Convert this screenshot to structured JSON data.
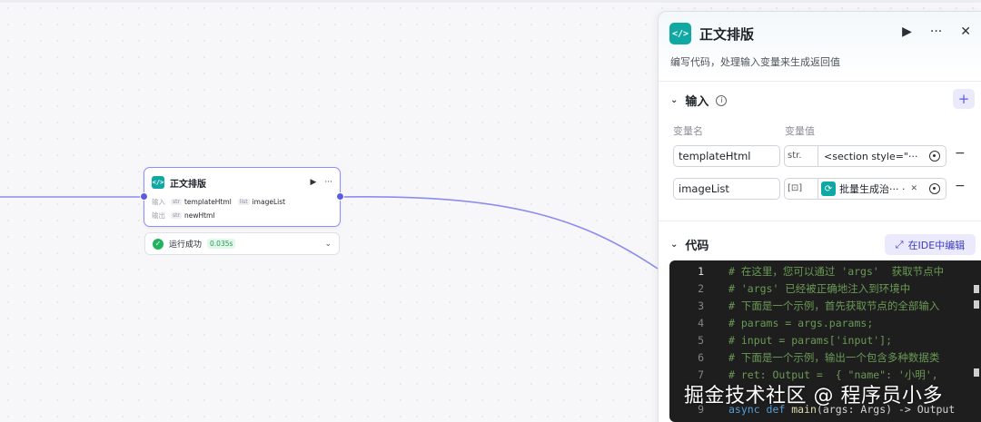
{
  "canvas": {
    "node": {
      "title": "正文排版",
      "input_label": "输入",
      "inputs": [
        {
          "type": "str",
          "name": "templateHtml"
        },
        {
          "type": "list",
          "name": "imageList"
        }
      ],
      "output_label": "输出",
      "outputs": [
        {
          "type": "str",
          "name": "newHtml"
        }
      ]
    },
    "status": {
      "text": "运行成功",
      "time": "0.035s"
    }
  },
  "panel": {
    "title": "正文排版",
    "description": "编写代码，处理输入变量来生成返回值",
    "input_section": {
      "title": "输入",
      "col_name": "变量名",
      "col_value": "变量值",
      "rows": [
        {
          "name": "templateHtml",
          "type": "str.",
          "value": "<section style=\"···"
        },
        {
          "name": "imageList",
          "type": "[⊡]",
          "value": "批量生成治··· ·"
        }
      ]
    },
    "code_section": {
      "title": "代码",
      "ide_button": "在IDE中编辑",
      "lines": [
        {
          "n": "1",
          "t": "# 在这里，您可以通过 'args'  获取节点中"
        },
        {
          "n": "2",
          "t": "# 'args' 已经被正确地注入到环境中"
        },
        {
          "n": "3",
          "t": "# 下面是一个示例，首先获取节点的全部输入"
        },
        {
          "n": "4",
          "t": "# params = args.params;"
        },
        {
          "n": "5",
          "t": "# input = params['input'];"
        },
        {
          "n": "6",
          "t": "# 下面是一个示例，输出一个包含多种数据类"
        },
        {
          "n": "7",
          "t": "# ret: Output =  { \"name\": '小明',"
        }
      ],
      "line9": {
        "n": "9",
        "kw": "async def ",
        "fn": "main",
        "rest": "(args: Args) -> Output"
      }
    }
  },
  "watermark": "掘金技术社区 @ 程序员小多",
  "colors": {
    "accent": "#5b5ce6",
    "teal": "#10a8a2",
    "success": "#22b35e"
  }
}
